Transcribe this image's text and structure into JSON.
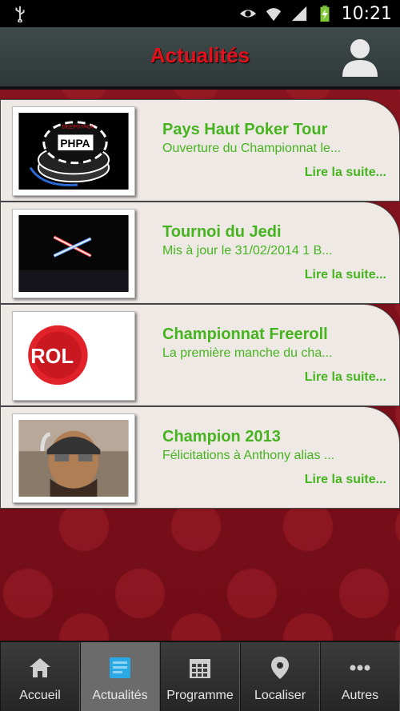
{
  "status_bar": {
    "time": "10:21",
    "icons": [
      "usb-icon",
      "eye-icon",
      "wifi-icon",
      "signal-icon",
      "battery-charging-icon"
    ]
  },
  "header": {
    "title": "Actualités",
    "profile_icon": "user-icon"
  },
  "news": [
    {
      "title": "Pays Haut Poker Tour",
      "description": "Ouverture du Championnat le...",
      "more": "Lire la suite...",
      "image": "poker-chips-logo"
    },
    {
      "title": "Tournoi du Jedi",
      "description": "Mis à jour le 31/02/2014 1 B...",
      "more": "Lire la suite...",
      "image": "lightsabers"
    },
    {
      "title": "Championnat Freeroll",
      "description": "La première manche du cha...",
      "more": "Lire la suite...",
      "image": "freeroll-badge",
      "image_text": "FREE ROL"
    },
    {
      "title": "Champion 2013",
      "description": "Félicitations à Anthony alias ...",
      "more": "Lire la suite...",
      "image": "player-photo"
    }
  ],
  "bottom_nav": {
    "items": [
      {
        "label": "Accueil",
        "icon": "home-icon",
        "active": false
      },
      {
        "label": "Actualités",
        "icon": "news-icon",
        "active": true
      },
      {
        "label": "Programme",
        "icon": "calendar-icon",
        "active": false
      },
      {
        "label": "Localiser",
        "icon": "map-pin-icon",
        "active": false
      },
      {
        "label": "Autres",
        "icon": "more-icon",
        "active": false
      }
    ]
  },
  "colors": {
    "title_red": "#e2111b",
    "news_green": "#46b41e",
    "active_icon_blue": "#2aa9e6"
  }
}
